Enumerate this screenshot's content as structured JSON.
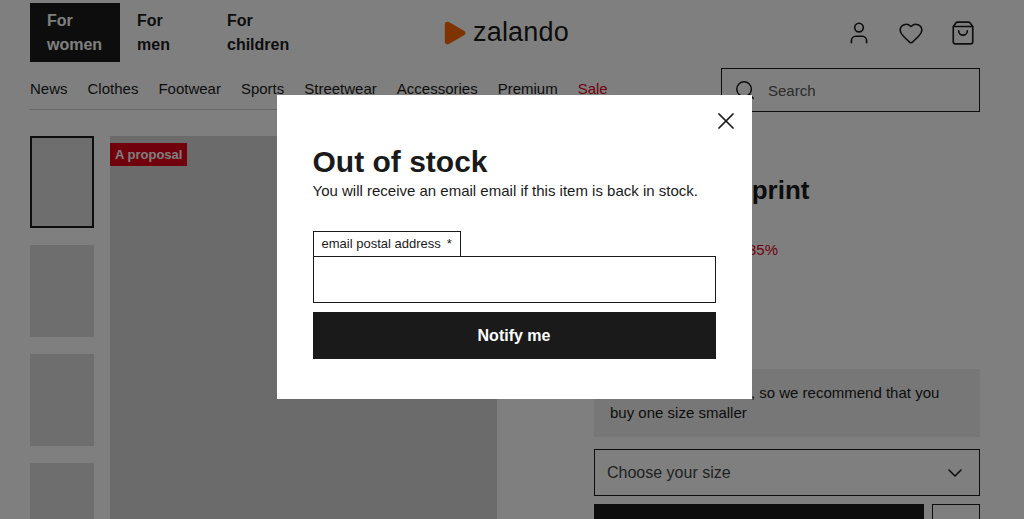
{
  "header": {
    "tabs": [
      {
        "label": "For women",
        "selected": true
      },
      {
        "label": "For men",
        "selected": false
      },
      {
        "label": "For children",
        "selected": false
      }
    ],
    "logo": "zalando"
  },
  "nav": [
    {
      "label": "News",
      "color": "#1a1a1a"
    },
    {
      "label": "Clothes",
      "color": "#1a1a1a"
    },
    {
      "label": "Footwear",
      "color": "#1a1a1a"
    },
    {
      "label": "Sports",
      "color": "#1a1a1a"
    },
    {
      "label": "Streetwear",
      "color": "#1a1a1a"
    },
    {
      "label": "Accessories",
      "color": "#1a1a1a"
    },
    {
      "label": "Premium",
      "color": "#1a1a1a"
    },
    {
      "label": "Sale",
      "color": "#e2001a"
    }
  ],
  "search": {
    "placeholder": "Search"
  },
  "gallery": {
    "badge": "A proposal",
    "thumbnails": [
      {
        "selected": true
      },
      {
        "selected": false
      },
      {
        "selected": false
      },
      {
        "selected": false
      }
    ]
  },
  "product": {
    "title": "a print",
    "discount": "35%",
    "size_note": "The size is increased, so we recommend that you buy one size smaller",
    "size_select": {
      "placeholder": "Choose your size",
      "expanded": false
    }
  },
  "modal": {
    "title": "Out of stock",
    "message": "You will receive an email email if this item is back in stock.",
    "field": {
      "label": "email postal address",
      "required_mark": "*",
      "value": ""
    },
    "button": "Notify me"
  }
}
